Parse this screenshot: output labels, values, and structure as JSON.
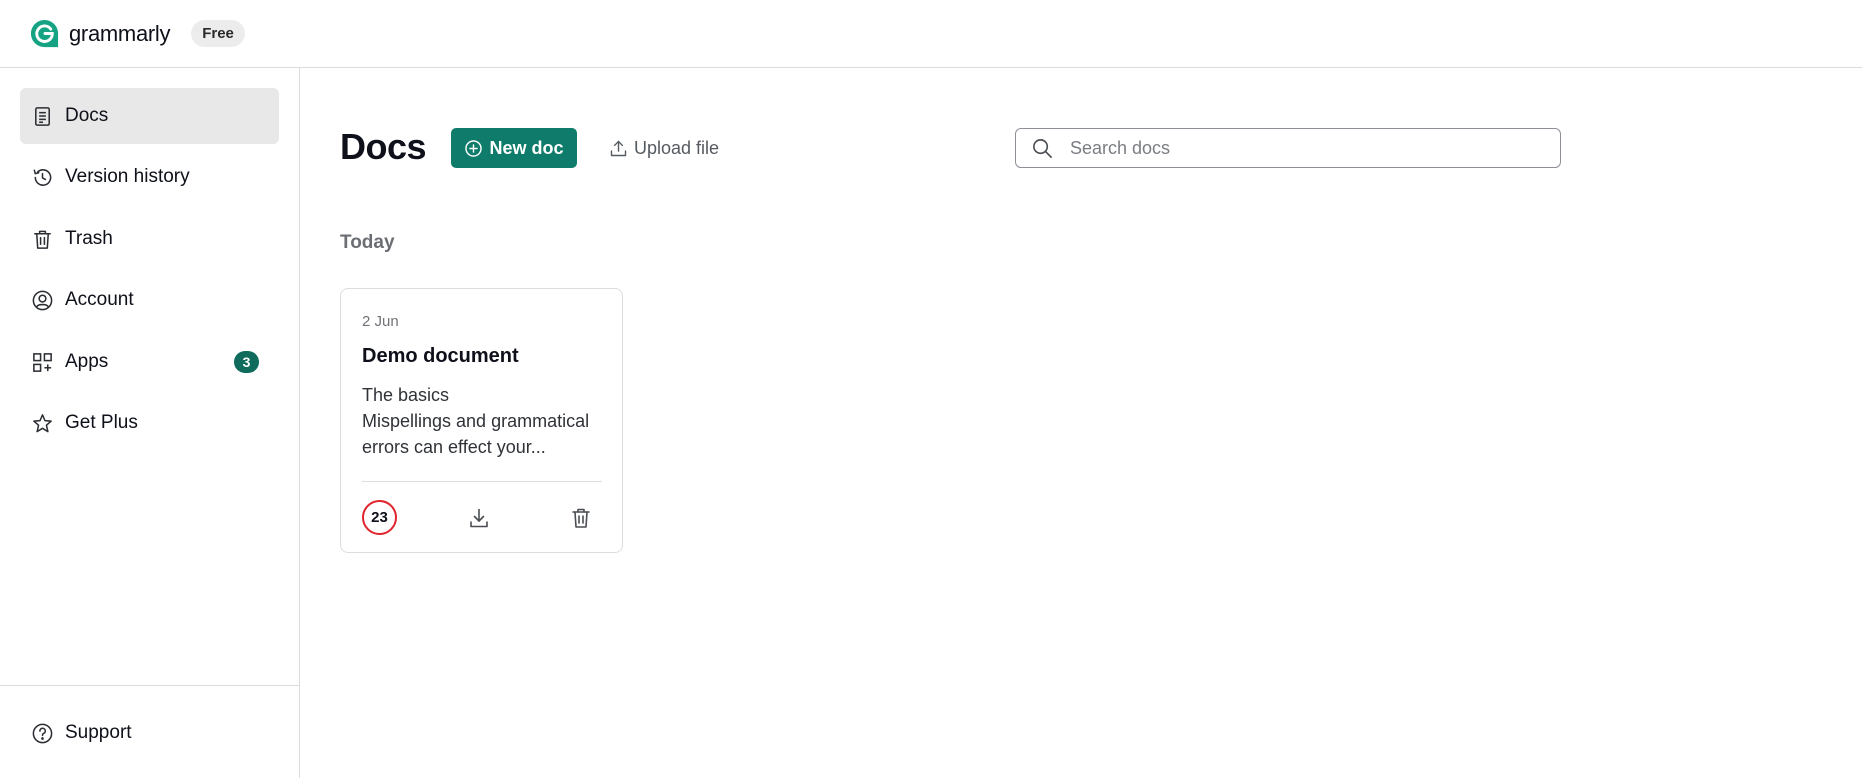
{
  "brand": {
    "name": "grammarly",
    "plan": "Free",
    "color": "#15c39a"
  },
  "sidebar": {
    "items": [
      {
        "label": "Docs",
        "icon": "document-icon",
        "active": true
      },
      {
        "label": "Version history",
        "icon": "history-icon"
      },
      {
        "label": "Trash",
        "icon": "trash-icon"
      },
      {
        "label": "Account",
        "icon": "account-icon"
      },
      {
        "label": "Apps",
        "icon": "apps-icon",
        "count": "3"
      },
      {
        "label": "Get Plus",
        "icon": "star-icon"
      }
    ],
    "support": {
      "label": "Support",
      "icon": "help-circle-icon"
    }
  },
  "main": {
    "title": "Docs",
    "new_doc_label": "New doc",
    "upload_label": "Upload file",
    "search_placeholder": "Search docs",
    "section_heading": "Today"
  },
  "documents": [
    {
      "date": "2 Jun",
      "title": "Demo document",
      "preview_lines": [
        "The basics",
        "Mispellings and grammatical",
        "errors can effect your..."
      ],
      "score": "23",
      "score_color": "#e0242d"
    }
  ],
  "colors": {
    "accent": "#0f7c6b",
    "active_nav_bg": "#e8e8e8",
    "badge_bg": "#0f6b5c"
  }
}
